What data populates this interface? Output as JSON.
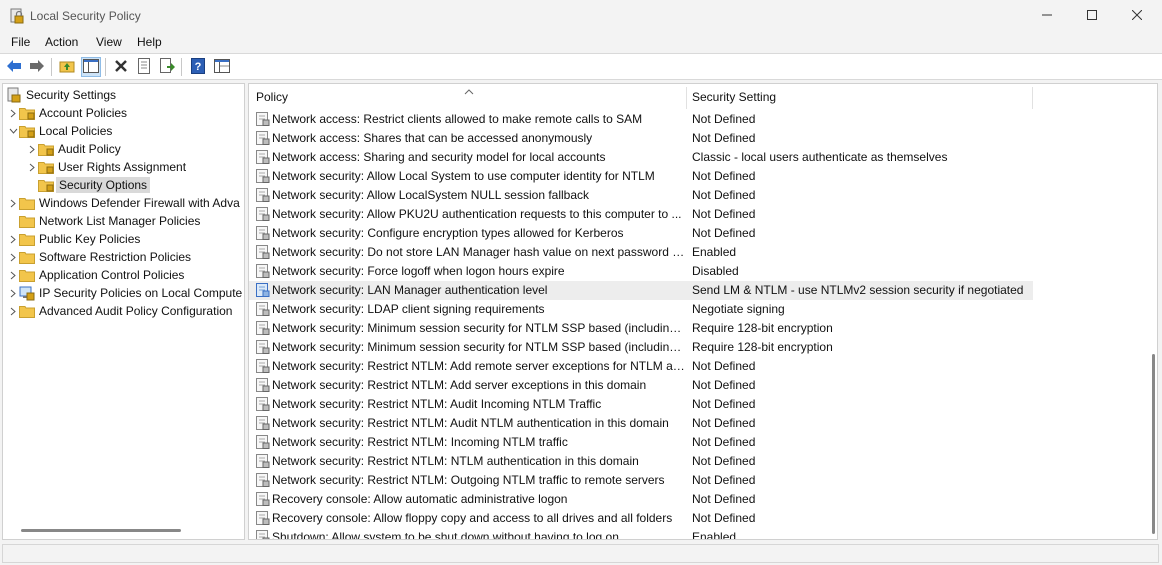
{
  "window": {
    "title": "Local Security Policy",
    "controls": [
      "minimize-icon",
      "maximize-icon",
      "close-icon"
    ]
  },
  "menu": [
    "File",
    "Action",
    "View",
    "Help"
  ],
  "toolbar": {
    "buttons": [
      "back-icon",
      "forward-icon",
      "up-folder-icon",
      "show-hide-tree-icon",
      "delete-icon",
      "properties-icon",
      "export-list-icon",
      "help-icon",
      "console-view-icon"
    ]
  },
  "tree": {
    "root": "Security Settings",
    "items": [
      {
        "label": "Account Policies",
        "expanded": false
      },
      {
        "label": "Local Policies",
        "expanded": true
      },
      {
        "label": "Audit Policy",
        "expanded": false
      },
      {
        "label": "User Rights Assignment",
        "expanded": false
      },
      {
        "label": "Security Options",
        "selected": true
      },
      {
        "label": "Windows Defender Firewall with Adva",
        "expanded": false
      },
      {
        "label": "Network List Manager Policies"
      },
      {
        "label": "Public Key Policies",
        "expanded": false
      },
      {
        "label": "Software Restriction Policies",
        "expanded": false
      },
      {
        "label": "Application Control Policies",
        "expanded": false
      },
      {
        "label": "IP Security Policies on Local Compute",
        "expanded": false
      },
      {
        "label": "Advanced Audit Policy Configuration",
        "expanded": false
      }
    ]
  },
  "list": {
    "columns": {
      "policy": "Policy",
      "setting": "Security Setting"
    },
    "selected_index": 9,
    "rows": [
      {
        "policy": "Network access: Restrict clients allowed to make remote calls to SAM",
        "setting": "Not Defined"
      },
      {
        "policy": "Network access: Shares that can be accessed anonymously",
        "setting": "Not Defined"
      },
      {
        "policy": "Network access: Sharing and security model for local accounts",
        "setting": "Classic - local users authenticate as themselves"
      },
      {
        "policy": "Network security: Allow Local System to use computer identity for NTLM",
        "setting": "Not Defined"
      },
      {
        "policy": "Network security: Allow LocalSystem NULL session fallback",
        "setting": "Not Defined"
      },
      {
        "policy": "Network security: Allow PKU2U authentication requests to this computer to ...",
        "setting": "Not Defined"
      },
      {
        "policy": "Network security: Configure encryption types allowed for Kerberos",
        "setting": "Not Defined"
      },
      {
        "policy": "Network security: Do not store LAN Manager hash value on next password c...",
        "setting": "Enabled"
      },
      {
        "policy": "Network security: Force logoff when logon hours expire",
        "setting": "Disabled"
      },
      {
        "policy": "Network security: LAN Manager authentication level",
        "setting": "Send LM & NTLM - use NTLMv2 session security if negotiated"
      },
      {
        "policy": "Network security: LDAP client signing requirements",
        "setting": "Negotiate signing"
      },
      {
        "policy": "Network security: Minimum session security for NTLM SSP based (including ...",
        "setting": "Require 128-bit encryption"
      },
      {
        "policy": "Network security: Minimum session security for NTLM SSP based (including ...",
        "setting": "Require 128-bit encryption"
      },
      {
        "policy": "Network security: Restrict NTLM: Add remote server exceptions for NTLM au...",
        "setting": "Not Defined"
      },
      {
        "policy": "Network security: Restrict NTLM: Add server exceptions in this domain",
        "setting": "Not Defined"
      },
      {
        "policy": "Network security: Restrict NTLM: Audit Incoming NTLM Traffic",
        "setting": "Not Defined"
      },
      {
        "policy": "Network security: Restrict NTLM: Audit NTLM authentication in this domain",
        "setting": "Not Defined"
      },
      {
        "policy": "Network security: Restrict NTLM: Incoming NTLM traffic",
        "setting": "Not Defined"
      },
      {
        "policy": "Network security: Restrict NTLM: NTLM authentication in this domain",
        "setting": "Not Defined"
      },
      {
        "policy": "Network security: Restrict NTLM: Outgoing NTLM traffic to remote servers",
        "setting": "Not Defined"
      },
      {
        "policy": "Recovery console: Allow automatic administrative logon",
        "setting": "Not Defined"
      },
      {
        "policy": "Recovery console: Allow floppy copy and access to all drives and all folders",
        "setting": "Not Defined"
      },
      {
        "policy": "Shutdown: Allow system to be shut down without having to log on",
        "setting": "Enabled"
      }
    ]
  },
  "colors": {
    "window_bg": "#f3f3f3",
    "panel_bg": "#ffffff",
    "selected_row": "#ededed",
    "tree_selected": "#d9d9d9",
    "folder": "#f2c54b",
    "lock": "#d4a017",
    "toolbar_blue": "#2d6fd1"
  }
}
